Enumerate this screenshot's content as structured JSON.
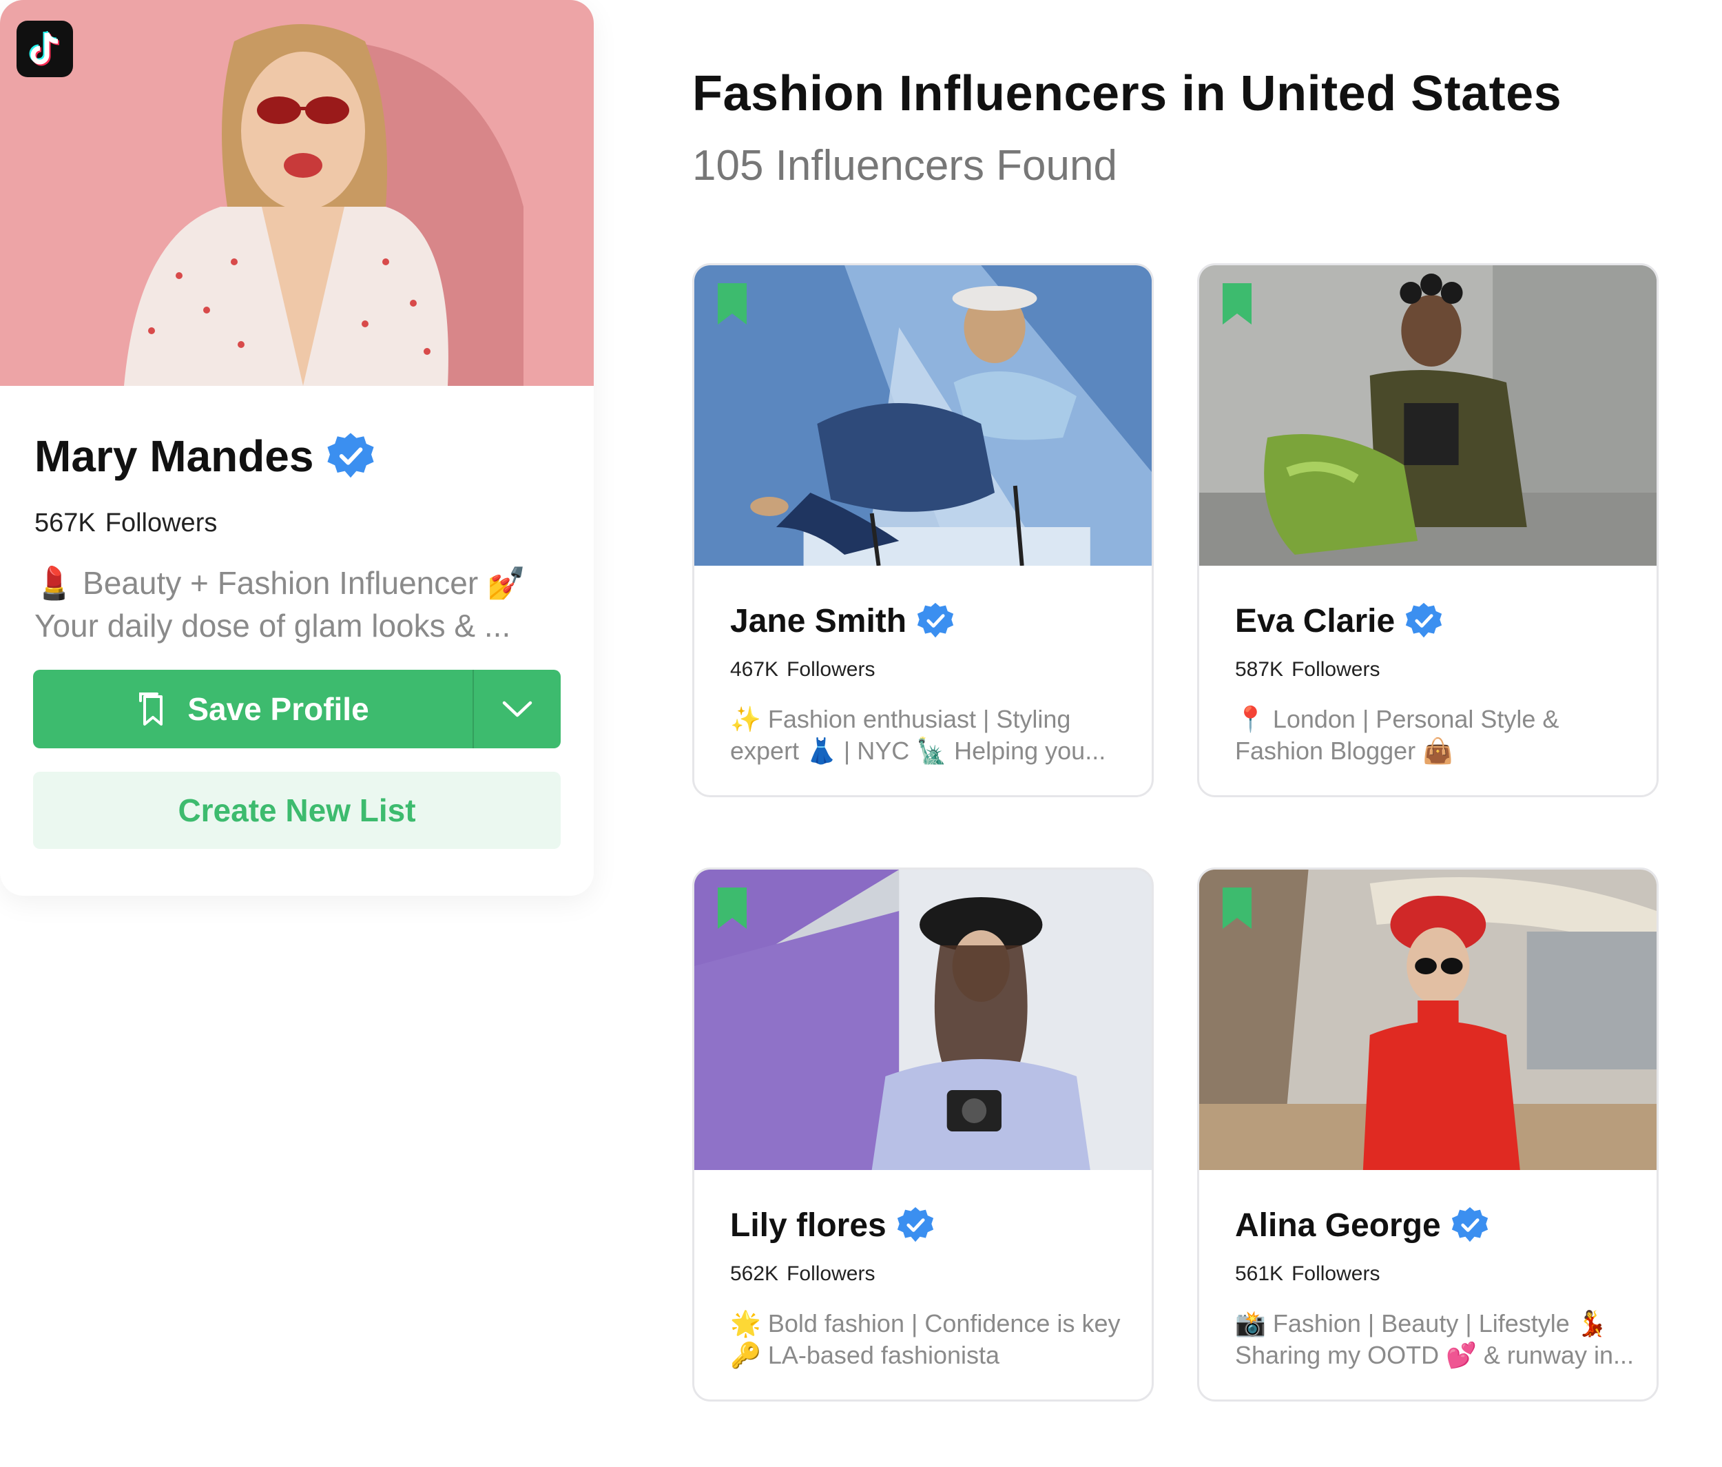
{
  "profile": {
    "name": "Mary Mandes",
    "followers_count": "567K",
    "followers_label": "Followers",
    "bio_line1": "💄 Beauty + Fashion Influencer 💅",
    "bio_line2": "Your daily dose of glam looks & ...",
    "save_label": "Save Profile",
    "create_list_label": "Create New List"
  },
  "results": {
    "title": "Fashion Influencers in United States",
    "count": "105 Influencers Found"
  },
  "cards": [
    {
      "name": "Jane Smith",
      "followers_count": "467K",
      "followers_label": "Followers",
      "bio_line1": "✨ Fashion enthusiast | Styling",
      "bio_line2": "expert 👗 | NYC 🗽 Helping you..."
    },
    {
      "name": "Eva Clarie",
      "followers_count": "587K",
      "followers_label": "Followers",
      "bio_line1": "📍 London | Personal Style &",
      "bio_line2": "Fashion Blogger 👜"
    },
    {
      "name": "Lily flores",
      "followers_count": "562K",
      "followers_label": "Followers",
      "bio_line1": "🌟 Bold fashion | Confidence is key",
      "bio_line2": "🔑 LA-based fashionista"
    },
    {
      "name": "Alina George",
      "followers_count": "561K",
      "followers_label": "Followers",
      "bio_line1": "📸 Fashion | Beauty | Lifestyle 💃",
      "bio_line2": "Sharing my OOTD 💕 & runway in..."
    }
  ],
  "colors": {
    "accent_green": "#3dbb6e",
    "light_green": "#ebf8f0",
    "verified_blue": "#3b8ff0",
    "muted_text": "#8a8a8a"
  }
}
